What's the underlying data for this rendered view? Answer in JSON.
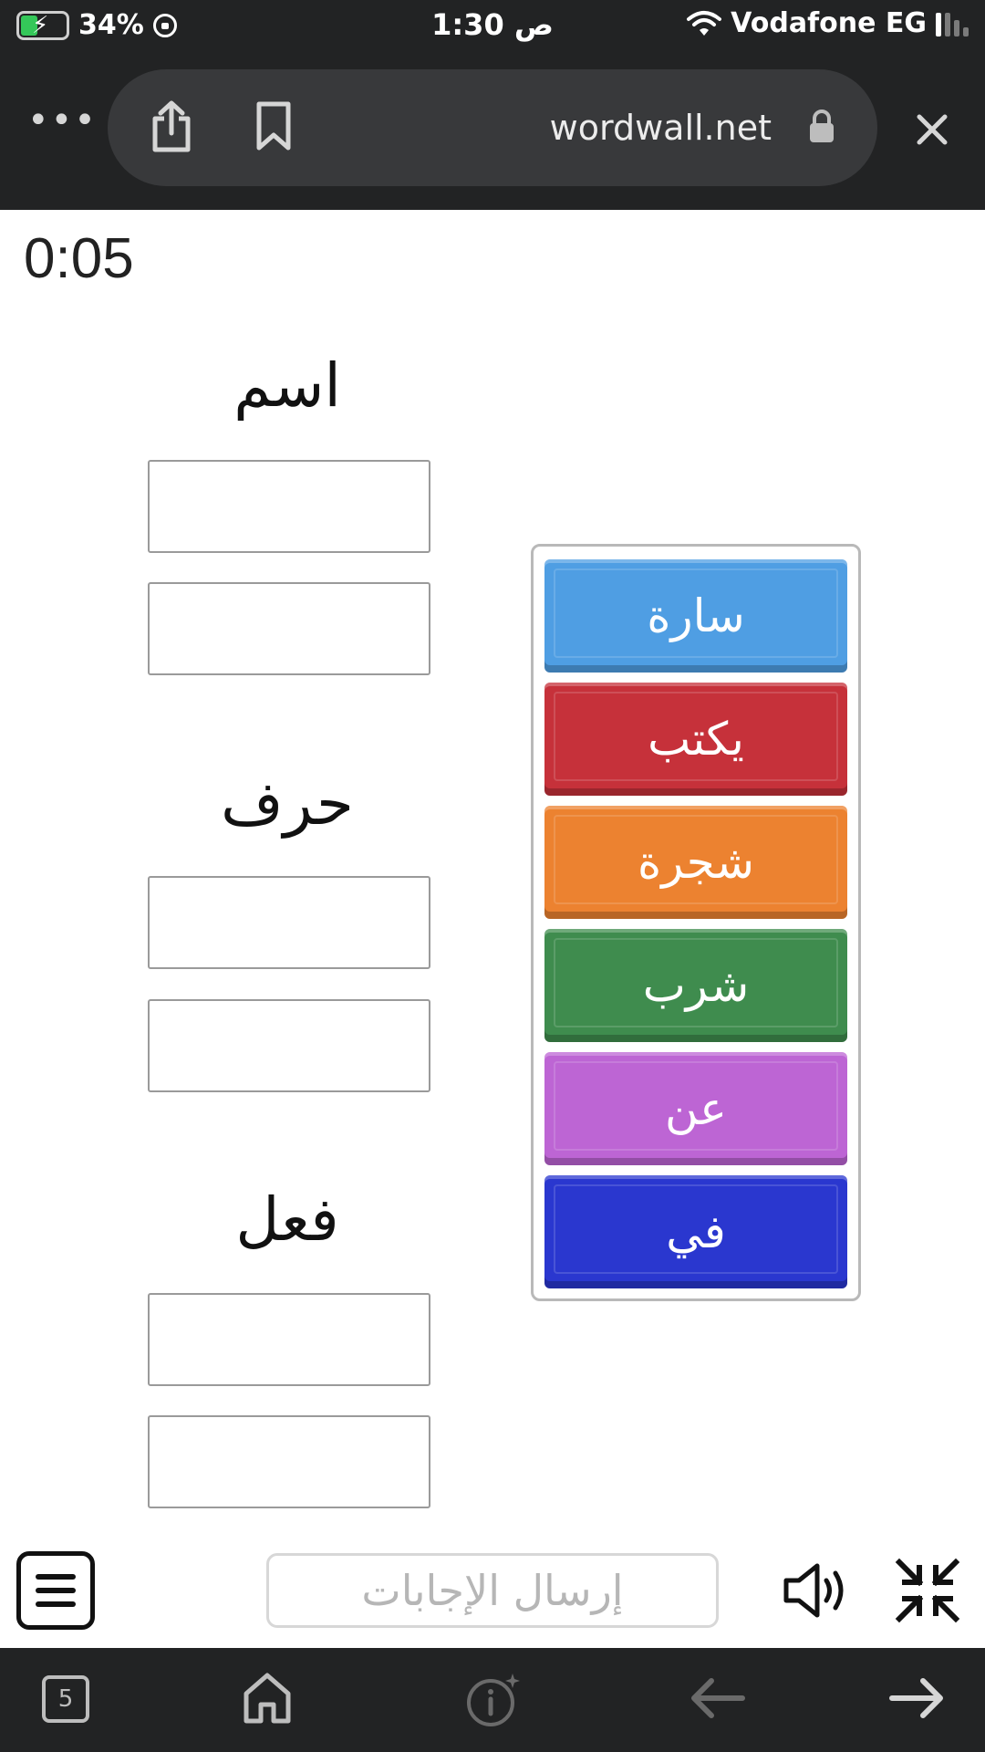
{
  "status_bar": {
    "battery_percent": "34%",
    "time": "1:30 ص",
    "carrier": "Vodafone EG"
  },
  "browser": {
    "url": "wordwall.net",
    "tab_count": "5"
  },
  "game": {
    "timer": "0:05",
    "groups": [
      {
        "label": "اسم"
      },
      {
        "label": "حرف"
      },
      {
        "label": "فعل"
      }
    ],
    "cards": [
      {
        "text": "سارة",
        "color": "#4f9ee3"
      },
      {
        "text": "يكتب",
        "color": "#c6313a"
      },
      {
        "text": "شجرة",
        "color": "#ec8230"
      },
      {
        "text": "شرب",
        "color": "#3f8c4e"
      },
      {
        "text": "عن",
        "color": "#bd65d4"
      },
      {
        "text": "في",
        "color": "#2a37cf"
      }
    ],
    "submit_label": "إرسال الإجابات"
  }
}
